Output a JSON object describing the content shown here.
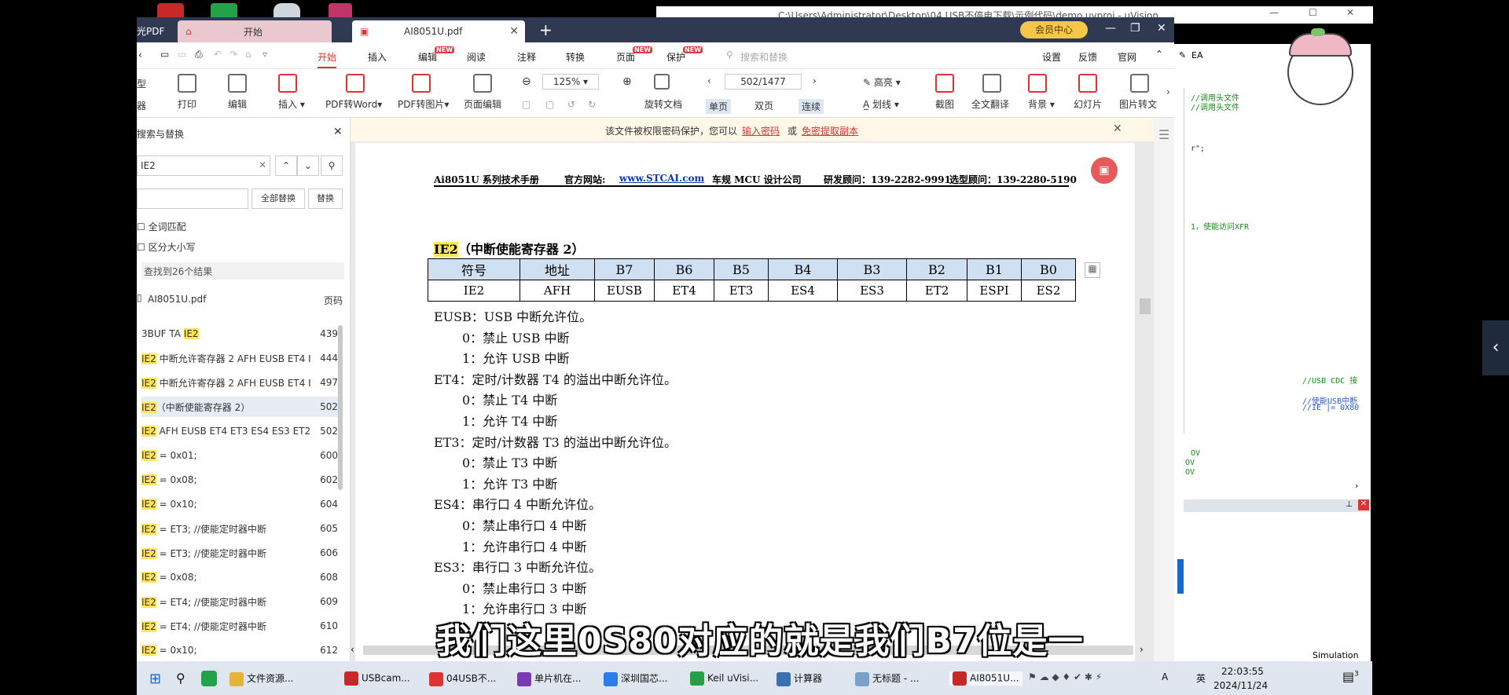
{
  "window": {
    "tabs": [
      {
        "label": "开始"
      },
      {
        "label": "AI8051U.pdf"
      }
    ],
    "top_left_app": "光PDF",
    "member_badge": "会员中心",
    "keil_title": "C:\\Users\\Administrator\\Desktop\\04 USB不停电下载\\示例代码\\demo.uvproj - µVision"
  },
  "menu": {
    "items": [
      "开始",
      "插入",
      "编辑",
      "阅读",
      "注释",
      "转换",
      "页面",
      "保护"
    ],
    "new_tags": [
      "NEW",
      "NEW",
      "NEW"
    ],
    "search_placeholder": "搜索和替换",
    "right": [
      "设置",
      "反馈",
      "官网"
    ]
  },
  "toolbar": {
    "left_edge": [
      "型",
      "器"
    ],
    "buttons": [
      "打印",
      "编辑",
      "插入",
      "PDF转Word",
      "PDF转图片",
      "页面编辑"
    ],
    "zoom": "125%",
    "page_indicator": "502/1477",
    "rotate_label": "旋转文档",
    "view_modes": [
      "单页",
      "双页",
      "连续"
    ],
    "highlight": "高亮",
    "underline": "划线",
    "right_buttons": [
      "截图",
      "全文翻译",
      "背景",
      "幻灯片",
      "图片转文"
    ]
  },
  "sidebar": {
    "title": "搜索与替换",
    "search_value": "IE2",
    "replace_all": "全部替换",
    "replace": "替换",
    "opt_whole": "全词匹配",
    "opt_case": "区分大小写",
    "result_count": "查找到26个结果",
    "file": "AI8051U.pdf",
    "page_col": "页码",
    "results": [
      {
        "pre": "3BUF TA ",
        "hit": "IE2",
        "post": "",
        "page": "439"
      },
      {
        "pre": "",
        "hit": "IE2",
        "post": " 中断允许寄存器 2 AFH EUSB ET4 I",
        "page": "444"
      },
      {
        "pre": "",
        "hit": "IE2",
        "post": " 中断允许寄存器 2 AFH EUSB ET4 I",
        "page": "497"
      },
      {
        "pre": "",
        "hit": "IE2",
        "post": "（中断使能寄存器 2）",
        "page": "502"
      },
      {
        "pre": "",
        "hit": "IE2",
        "post": " AFH EUSB ET4 ET3 ES4 ES3 ET2",
        "page": "502"
      },
      {
        "pre": "",
        "hit": "IE2",
        "post": " = 0x01;",
        "page": "600"
      },
      {
        "pre": "",
        "hit": "IE2",
        "post": " = 0x08;",
        "page": "602"
      },
      {
        "pre": "",
        "hit": "IE2",
        "post": " = 0x10;",
        "page": "604"
      },
      {
        "pre": "",
        "hit": "IE2",
        "post": " = ET3; //使能定时器中断",
        "page": "605"
      },
      {
        "pre": "",
        "hit": "IE2",
        "post": " = ET3; //使能定时器中断",
        "page": "606"
      },
      {
        "pre": "",
        "hit": "IE2",
        "post": " = 0x08;",
        "page": "608"
      },
      {
        "pre": "",
        "hit": "IE2",
        "post": " = ET4; //使能定时器中断",
        "page": "609"
      },
      {
        "pre": "",
        "hit": "IE2",
        "post": " = ET4; //使能定时器中断",
        "page": "610"
      },
      {
        "pre": "",
        "hit": "IE2",
        "post": " = 0x10;",
        "page": "612"
      }
    ]
  },
  "notice": {
    "text": "该文件被权限密码保护，您可以",
    "link1": "输入密码",
    "or": "或",
    "link2": "免密提取副本"
  },
  "document": {
    "header": {
      "title": "Ai8051U 系列技术手册",
      "site_label": "官方网站: ",
      "site": "www.STCAI.com",
      "company": "车规 MCU 设计公司",
      "rd": "研发顾问：139-2282-9991",
      "sel": "选型顾问：139-2280-5190"
    },
    "section_hit": "IE2",
    "section_rest": "（中断使能寄存器 2）",
    "table_header": [
      "符号",
      "地址",
      "B7",
      "B6",
      "B5",
      "B4",
      "B3",
      "B2",
      "B1",
      "B0"
    ],
    "table_row": [
      "IE2",
      "AFH",
      "EUSB",
      "ET4",
      "ET3",
      "ES4",
      "ES3",
      "ET2",
      "ESPI",
      "ES2"
    ],
    "lines": [
      {
        "t": "EUSB：USB 中断允许位。",
        "indent": false
      },
      {
        "t": "0：禁止 USB 中断",
        "indent": true
      },
      {
        "t": "1：允许 USB 中断",
        "indent": true
      },
      {
        "t": "ET4：定时/计数器 T4 的溢出中断允许位。",
        "indent": false
      },
      {
        "t": "0：禁止 T4 中断",
        "indent": true
      },
      {
        "t": "1：允许 T4 中断",
        "indent": true
      },
      {
        "t": "ET3：定时/计数器 T3 的溢出中断允许位。",
        "indent": false
      },
      {
        "t": "0：禁止 T3 中断",
        "indent": true
      },
      {
        "t": "1：允许 T3 中断",
        "indent": true
      },
      {
        "t": "ES4：串行口 4 中断允许位。",
        "indent": false
      },
      {
        "t": "0：禁止串行口 4 中断",
        "indent": true
      },
      {
        "t": "1：允许串行口 4 中断",
        "indent": true
      },
      {
        "t": "ES3：串行口 3 中断允许位。",
        "indent": false
      },
      {
        "t": "0：禁止串行口 3 中断",
        "indent": true
      },
      {
        "t": "1：允许串行口 3 中断",
        "indent": true
      }
    ]
  },
  "keil": {
    "toolbar_label": "EA",
    "code": [
      "//调用头文件",
      "//调用头文件",
      "r\";",
      "1，使能访问XFR",
      "//USB CDC 接",
      "//使能USB中断",
      "//IE |= 0X80",
      "OV",
      "OV",
      "OV"
    ],
    "status": "Simulation"
  },
  "subtitle": "我们这里0S80对应的就是我们B7位是一",
  "taskbar": {
    "items": [
      "文件资源...",
      "USBcam...",
      "04USB不...",
      "单片机在...",
      "深圳国芯...",
      "Keil uVisi...",
      "计算器",
      "无标题 - ...",
      "AI8051U..."
    ],
    "time": "22:03:55",
    "date": "2024/11/24",
    "ime": "A",
    "ime2": "英",
    "notif": "3"
  },
  "colors": {
    "accent": "#e4393c",
    "tab_bar": "#2f3a52",
    "highlight": "#ffe45c",
    "table_header": "#cfe0f3",
    "code_green": "#1a8f1a",
    "link": "#0b3aa8"
  }
}
